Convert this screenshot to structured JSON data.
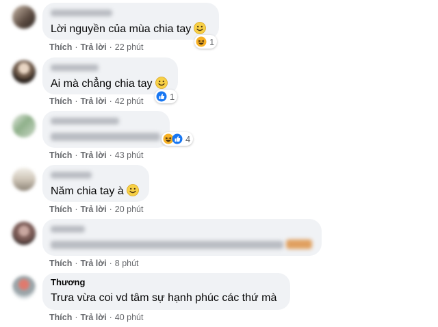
{
  "comments": [
    {
      "text": "Lời nguyền của mùa chia tay",
      "like_label": "Thích",
      "reply_label": "Trả lời",
      "time": "22 phút",
      "reaction_count": "1"
    },
    {
      "text": "Ai mà chẳng chia tay",
      "like_label": "Thích",
      "reply_label": "Trả lời",
      "time": "42 phút",
      "reaction_count": "1"
    },
    {
      "like_label": "Thích",
      "reply_label": "Trả lời",
      "time": "43 phút",
      "reaction_count": "4"
    },
    {
      "text": "Năm chia tay à",
      "like_label": "Thích",
      "reply_label": "Trả lời",
      "time": "20 phút"
    },
    {
      "like_label": "Thích",
      "reply_label": "Trả lời",
      "time": "8 phút"
    },
    {
      "author": "Thương",
      "text": "Trưa vừa coi vd tâm sự hạnh phúc các thứ mà",
      "like_label": "Thích",
      "reply_label": "Trả lời",
      "time": "40 phút"
    }
  ],
  "colors": {
    "bubble": "#f0f2f5",
    "action_text": "#65676b",
    "like_blue": "#1877f2",
    "haha_yellow": "#f7b125"
  },
  "icons": [
    "smile-emoji-icon",
    "haha-reaction-icon",
    "like-reaction-icon"
  ]
}
